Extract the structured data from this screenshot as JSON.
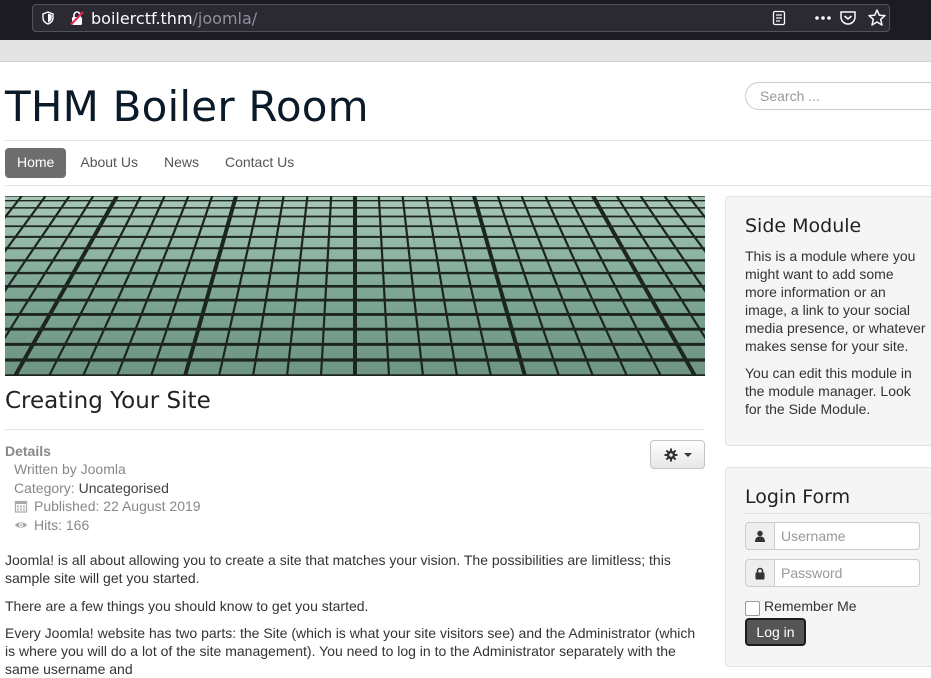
{
  "browser": {
    "url_host": "boilerctf.thm",
    "url_path": "/joomla/"
  },
  "header": {
    "site_title": "THM Boiler Room",
    "search_placeholder": "Search ..."
  },
  "nav": {
    "items": [
      {
        "label": "Home",
        "active": true
      },
      {
        "label": "About Us",
        "active": false
      },
      {
        "label": "News",
        "active": false
      },
      {
        "label": "Contact Us",
        "active": false
      }
    ]
  },
  "article": {
    "title": "Creating Your Site",
    "details_label": "Details",
    "written_by": "Written by Joomla",
    "category_prefix": "Category: ",
    "category": "Uncategorised",
    "published": "Published: 22 August 2019",
    "hits": "Hits: 166",
    "paragraphs": [
      "Joomla! is all about allowing you to create a site that matches your vision. The possibilities are limitless; this sample site will get you started.",
      "There are a few things you should know to get you started.",
      "Every Joomla! website has two parts: the Site (which is what your site visitors see) and the Administrator (which is where you will do a lot of the site management). You need to log in to the Administrator separately with the same username and"
    ]
  },
  "side_module": {
    "title": "Side Module",
    "p1": "This is a module where you might want to add some more information or an image, a link to your social media presence, or whatever makes sense for your site.",
    "p2": "You can edit this module in the module manager. Look for the Side Module."
  },
  "login_form": {
    "title": "Login Form",
    "username_placeholder": "Username",
    "password_placeholder": "Password",
    "remember_label": "Remember Me",
    "login_button": "Log in"
  },
  "icons": {
    "shield": "shield-icon",
    "insecure_lock": "insecure-lock-icon",
    "reader": "reader-view-icon",
    "more": "more-icon",
    "pocket": "pocket-icon",
    "star": "bookmark-star-icon",
    "gear": "gear-icon",
    "user": "user-icon",
    "lock": "lock-icon",
    "calendar": "calendar-icon",
    "eye": "eye-icon"
  },
  "colors": {
    "nav_active_bg": "#6e6e6e",
    "browser_bg": "#1c1b22",
    "module_bg": "#f5f5f5"
  }
}
